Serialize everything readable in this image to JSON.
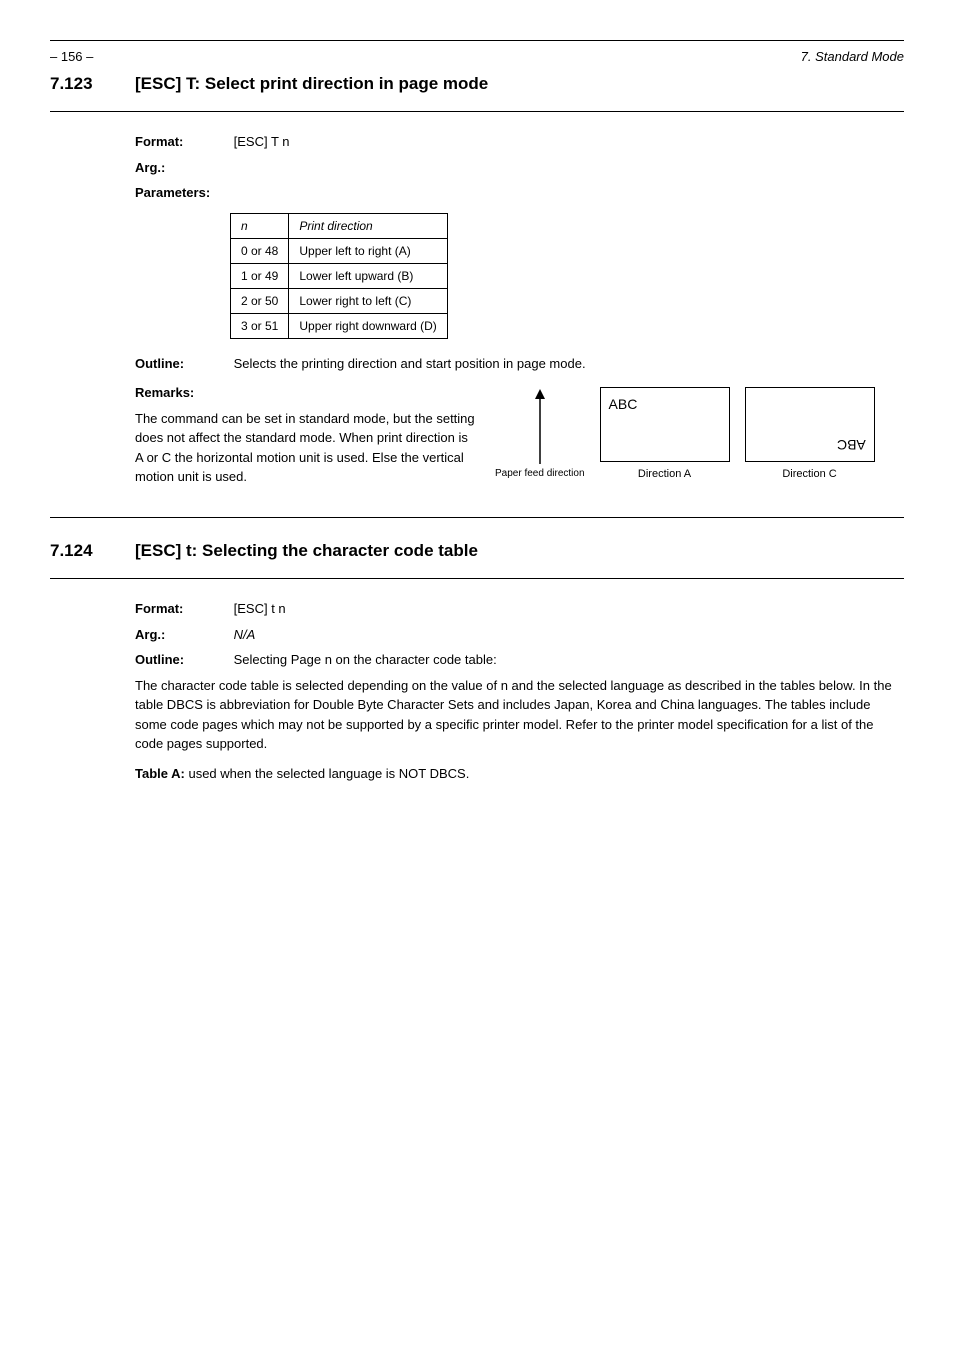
{
  "header": {
    "page": "– 156 –",
    "ref": "7. Standard Mode"
  },
  "section1": {
    "label": "7.123",
    "title": "[ESC] T: Select print direction in page mode",
    "format_label": "Format:",
    "format_value": "[ESC] T n",
    "arg_label": "Arg.:",
    "params_label": "Parameters:",
    "params": {
      "head_n": "n",
      "head_mode": "Print direction",
      "rows": [
        {
          "n": "0 or 48",
          "mode": "Upper left to right (A)"
        },
        {
          "n": "1 or 49",
          "mode": "Lower left upward (B)"
        },
        {
          "n": "2 or 50",
          "mode": "Lower right to left (C)"
        },
        {
          "n": "3 or 51",
          "mode": "Upper right downward (D)"
        }
      ]
    },
    "outline_label": "Outline:",
    "outline_text": "Selects the printing direction and start position in page mode.",
    "remarks_label": "Remarks:",
    "remarks_text": "The command can be set in standard mode, but the setting does not affect the standard mode. When print direction is A or C the horizontal motion unit is used. Else the vertical motion unit is used.",
    "diagram": {
      "feed": "Paper feed direction",
      "abc": "ABC",
      "cap_a": "Direction A",
      "cap_c": "Direction C"
    }
  },
  "section2": {
    "label": "7.124",
    "title": "[ESC] t: Selecting the character code table",
    "format_label": "Format:",
    "format_value": "[ESC] t n",
    "arg_label": "Arg.:",
    "na": "N/A",
    "outline_label": "Outline:",
    "outline_text": "Selecting Page n on the character code table:",
    "body": "The character code table is selected depending on the value of n and the selected language as described in the tables below. In the table DBCS is abbreviation for Double Byte Character Sets and includes Japan, Korea and China languages. The tables include some code pages which may not be supported by a specific printer model. Refer to the printer model specification for a list of the code pages supported.",
    "table_a_label": "Table A:",
    "table_a_text": "used when the selected language is NOT DBCS."
  }
}
